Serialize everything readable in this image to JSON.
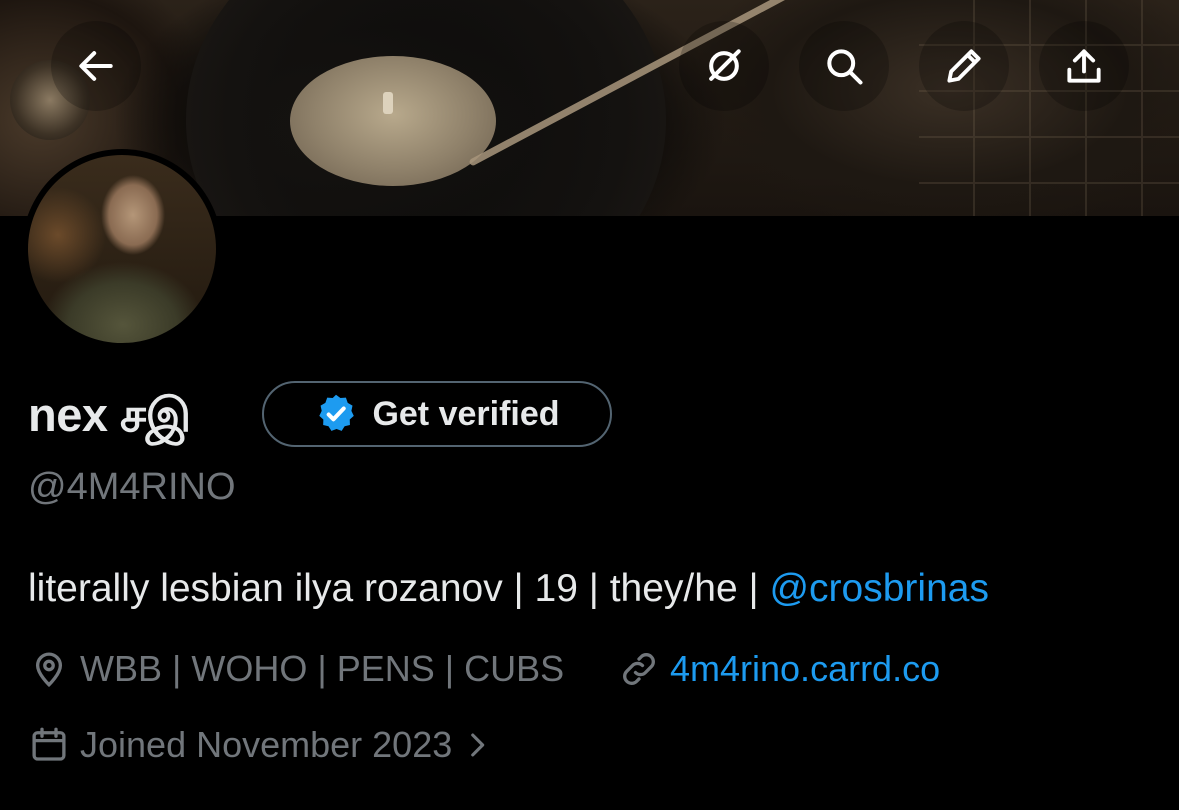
{
  "header": {
    "back_icon": "arrow-left-icon",
    "actions": [
      "grok-icon",
      "search-icon",
      "edit-icon",
      "share-icon"
    ]
  },
  "profile": {
    "display_name": "nex சஇ",
    "verify_label": "Get verified",
    "handle": "@4M4RINO",
    "bio_text": "literally lesbian ilya rozanov | 19 | they/he | ",
    "bio_mention": "@crosbrinas",
    "location": "WBB | WOHO | PENS | CUBS",
    "website": "4m4rino.carrd.co",
    "joined": "Joined November 2023"
  },
  "colors": {
    "accent": "#1d9bf0",
    "muted": "#71767b",
    "text": "#e7e9ea",
    "background": "#000000"
  }
}
